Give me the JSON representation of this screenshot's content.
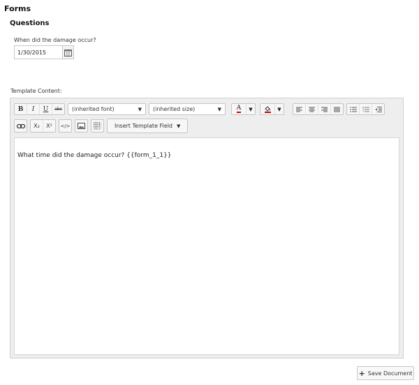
{
  "page": {
    "title": "Forms"
  },
  "questions": {
    "title": "Questions",
    "items": [
      {
        "label": "When did the damage occur?",
        "value": "1/30/2015",
        "icon": "calendar-icon"
      }
    ]
  },
  "template": {
    "label": "Template Content:",
    "toolbar": {
      "format_buttons": [
        "B",
        "I",
        "U",
        "abc"
      ],
      "font_dropdown": "(inherited font)",
      "size_dropdown": "(inherited size)",
      "font_color_glyph": "A",
      "font_color": "#cc0000",
      "highlight_color": "#cc0000",
      "align_icons": [
        "align-left-icon",
        "align-center-icon",
        "align-right-icon",
        "align-justify-icon"
      ],
      "list_icons": [
        "bullet-list-icon",
        "numbered-list-icon",
        "outdent-icon"
      ],
      "row2_icons": [
        "link-icon",
        "subscript-icon",
        "superscript-icon",
        "code-icon",
        "image-icon",
        "table-icon"
      ],
      "subscript_glyph": "X₂",
      "superscript_glyph": "X²",
      "code_glyph": "</>",
      "insert_field_label": "Insert Template Field",
      "caret": "▼"
    },
    "content": "What time did the damage occur? {{form_1_1}}"
  },
  "actions": {
    "save_label": "Save Document",
    "save_icon": "plus-icon"
  }
}
